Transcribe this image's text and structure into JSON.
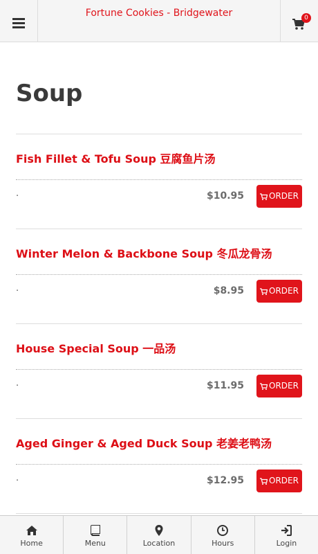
{
  "header": {
    "title": "Fortune Cookies - Bridgewater",
    "cart_count": "0"
  },
  "page": {
    "title": "Soup"
  },
  "items": [
    {
      "name": "Fish Fillet & Tofu Soup 豆腐鱼片汤",
      "desc": ".",
      "price": "$10.95",
      "order_label": "ORDER"
    },
    {
      "name": "Winter Melon & Backbone Soup 冬瓜龙骨汤",
      "desc": ".",
      "price": "$8.95",
      "order_label": "ORDER"
    },
    {
      "name": "House Special Soup 一品汤",
      "desc": ".",
      "price": "$11.95",
      "order_label": "ORDER"
    },
    {
      "name": "Aged Ginger & Aged Duck Soup 老姜老鸭汤",
      "desc": ".",
      "price": "$12.95",
      "order_label": "ORDER"
    }
  ],
  "nav": [
    {
      "label": "Home",
      "icon": "home-icon"
    },
    {
      "label": "Menu",
      "icon": "book-icon"
    },
    {
      "label": "Location",
      "icon": "map-marker-icon"
    },
    {
      "label": "Hours",
      "icon": "clock-icon"
    },
    {
      "label": "Login",
      "icon": "sign-in-icon"
    }
  ],
  "colors": {
    "accent": "#e0141b",
    "title": "#3a3a3a",
    "price": "#6b6b6b"
  }
}
